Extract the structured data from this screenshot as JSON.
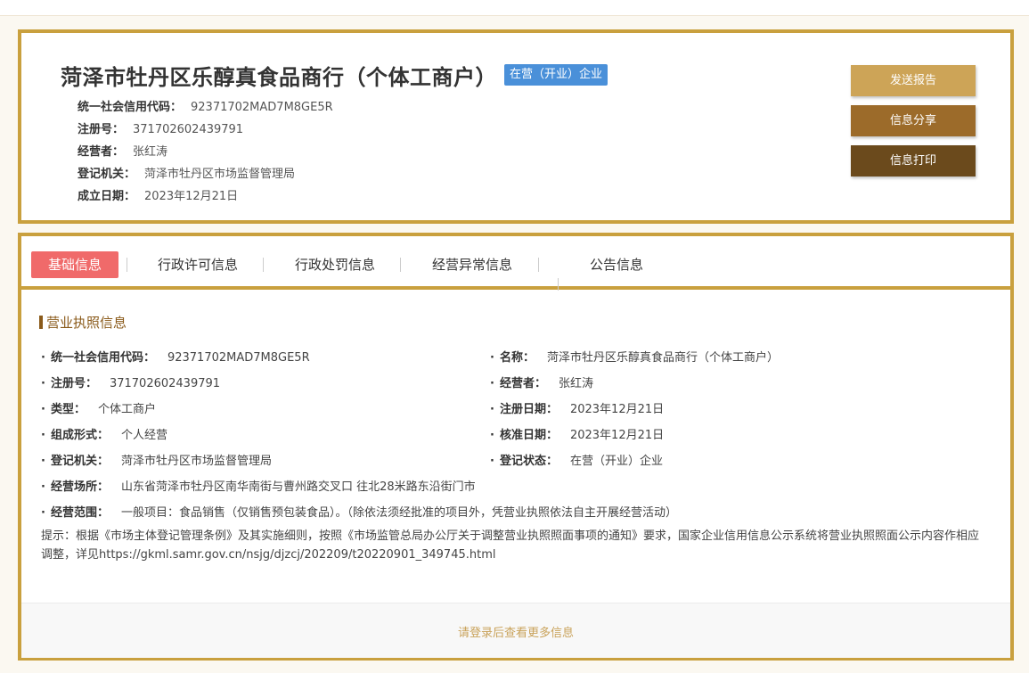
{
  "header": {
    "company_name": "菏泽市牡丹区乐醇真食品商行（个体工商户）",
    "status_badge": "在营（开业）企业",
    "fields": [
      {
        "label": "统一社会信用代码：",
        "value": "92371702MAD7M8GE5R"
      },
      {
        "label": "注册号：",
        "value": "371702602439791"
      },
      {
        "label": "经营者：",
        "value": "张红涛"
      },
      {
        "label": "登记机关：",
        "value": "菏泽市牡丹区市场监督管理局"
      },
      {
        "label": "成立日期：",
        "value": "2023年12月21日"
      }
    ],
    "buttons": {
      "send_report": "发送报告",
      "share": "信息分享",
      "print": "信息打印"
    }
  },
  "tabs": [
    "基础信息",
    "行政许可信息",
    "行政处罚信息",
    "经营异常信息",
    "公告信息"
  ],
  "license_section": {
    "title": "营业执照信息",
    "left": [
      {
        "label": "统一社会信用代码：",
        "value": "92371702MAD7M8GE5R"
      },
      {
        "label": "注册号：",
        "value": "371702602439791"
      },
      {
        "label": "类型：",
        "value": "个体工商户"
      },
      {
        "label": "组成形式：",
        "value": "个人经营"
      },
      {
        "label": "登记机关：",
        "value": "菏泽市牡丹区市场监督管理局"
      },
      {
        "label": "经营场所：",
        "value": "山东省菏泽市牡丹区南华南街与曹州路交叉口 往北28米路东沿街门市"
      },
      {
        "label": "经营范围：",
        "value": "一般项目：食品销售（仅销售预包装食品）。（除依法须经批准的项目外，凭营业执照依法自主开展经营活动）"
      }
    ],
    "right": [
      {
        "label": "名称：",
        "value": "菏泽市牡丹区乐醇真食品商行（个体工商户）"
      },
      {
        "label": "经营者：",
        "value": "张红涛"
      },
      {
        "label": "注册日期：",
        "value": "2023年12月21日"
      },
      {
        "label": "核准日期：",
        "value": "2023年12月21日"
      },
      {
        "label": "登记状态：",
        "value": "在营（开业）企业"
      }
    ],
    "bullet": "·",
    "notice": "提示：根据《市场主体登记管理条例》及其实施细则，按照《市场监管总局办公厅关于调整营业执照照面事项的通知》要求，国家企业信用信息公示系统将营业执照照面公示内容作相应调整，详见https://gkml.samr.gov.cn/nsjg/djzcj/202209/t20220901_349745.html"
  },
  "footer": {
    "login_prompt": "请登录后查看更多信息"
  }
}
